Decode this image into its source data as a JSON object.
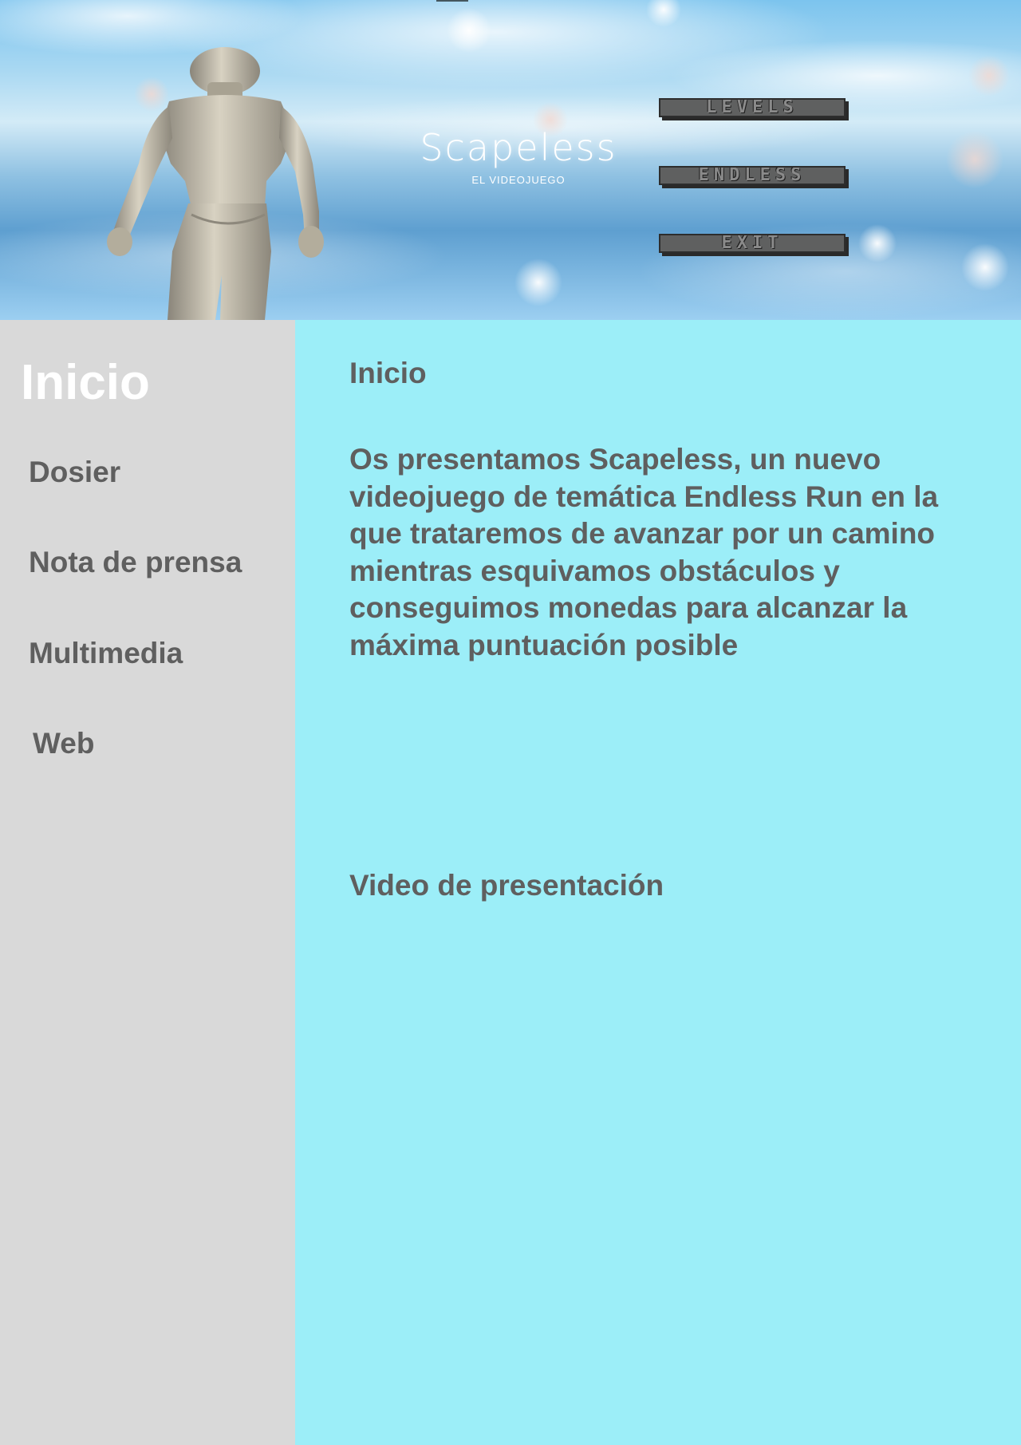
{
  "banner": {
    "game_title": "Scapeless",
    "game_subtitle": "EL VIDEOJUEGO",
    "menu": {
      "levels": "LEVELS",
      "endless": "ENDLESS",
      "exit": "EXIT"
    }
  },
  "sidebar": {
    "heading": "Inicio",
    "items": [
      {
        "label": "Dosier"
      },
      {
        "label": "Nota de prensa"
      },
      {
        "label": "Multimedia"
      },
      {
        "label": "Web"
      }
    ]
  },
  "main": {
    "heading": "Inicio",
    "intro": "Os presentamos Scapeless, un nuevo videojuego de temática Endless Run en la que trataremos de avanzar por un camino mientras esquivamos obstáculos y conseguimos monedas para alcanzar la máxima puntuación posible",
    "video_heading": "Video de presentación"
  },
  "colors": {
    "sidebar_bg": "#d9d9d9",
    "main_bg": "#9ceef8",
    "text": "#5f5f5f",
    "sidebar_heading": "#ffffff"
  }
}
